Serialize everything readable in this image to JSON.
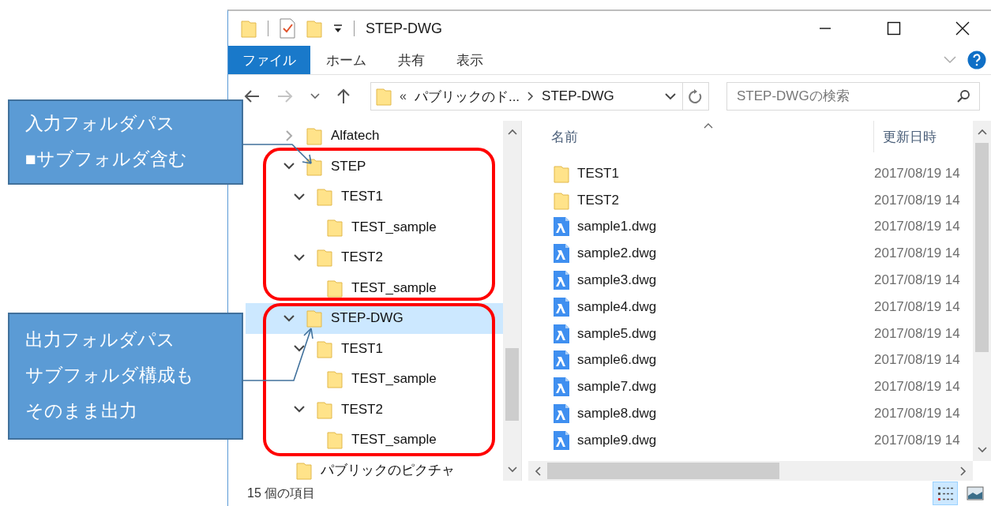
{
  "window": {
    "title": "STEP-DWG"
  },
  "ribbon": {
    "tabs": [
      {
        "label": "ファイル",
        "selected": true
      },
      {
        "label": "ホーム",
        "selected": false
      },
      {
        "label": "共有",
        "selected": false
      },
      {
        "label": "表示",
        "selected": false
      }
    ]
  },
  "address_bar": {
    "overflow": "«",
    "path": [
      "パブリックのド...",
      "STEP-DWG"
    ]
  },
  "search": {
    "placeholder": "STEP-DWGの検索"
  },
  "nav_pane": {
    "items": [
      {
        "name": "Alfatech",
        "expanded": false,
        "selected": false
      },
      {
        "name": "STEP",
        "expanded": true,
        "selected": false,
        "children": [
          {
            "name": "TEST1",
            "expanded": true,
            "selected": false,
            "children": [
              {
                "name": "TEST_sample",
                "selected": false
              }
            ]
          },
          {
            "name": "TEST2",
            "expanded": true,
            "selected": false,
            "children": [
              {
                "name": "TEST_sample",
                "selected": false
              }
            ]
          }
        ]
      },
      {
        "name": "STEP-DWG",
        "expanded": true,
        "selected": true,
        "children": [
          {
            "name": "TEST1",
            "expanded": true,
            "selected": false,
            "children": [
              {
                "name": "TEST_sample",
                "selected": false
              }
            ]
          },
          {
            "name": "TEST2",
            "expanded": true,
            "selected": false,
            "children": [
              {
                "name": "TEST_sample",
                "selected": false
              }
            ]
          }
        ]
      }
    ],
    "parent_level_items": [
      {
        "name": "パブリックのピクチャ",
        "selected": false
      }
    ]
  },
  "file_list": {
    "columns": [
      "名前",
      "更新日時"
    ],
    "rows": [
      {
        "kind": "folder",
        "name": "TEST1",
        "modified": "2017/08/19 14"
      },
      {
        "kind": "folder",
        "name": "TEST2",
        "modified": "2017/08/19 14"
      },
      {
        "kind": "dwg",
        "name": "sample1.dwg",
        "modified": "2017/08/19 14"
      },
      {
        "kind": "dwg",
        "name": "sample2.dwg",
        "modified": "2017/08/19 14"
      },
      {
        "kind": "dwg",
        "name": "sample3.dwg",
        "modified": "2017/08/19 14"
      },
      {
        "kind": "dwg",
        "name": "sample4.dwg",
        "modified": "2017/08/19 14"
      },
      {
        "kind": "dwg",
        "name": "sample5.dwg",
        "modified": "2017/08/19 14"
      },
      {
        "kind": "dwg",
        "name": "sample6.dwg",
        "modified": "2017/08/19 14"
      },
      {
        "kind": "dwg",
        "name": "sample7.dwg",
        "modified": "2017/08/19 14"
      },
      {
        "kind": "dwg",
        "name": "sample8.dwg",
        "modified": "2017/08/19 14"
      },
      {
        "kind": "dwg",
        "name": "sample9.dwg",
        "modified": "2017/08/19 14"
      }
    ]
  },
  "status_bar": {
    "item_count": "15 個の項目",
    "views": [
      {
        "kind": "details",
        "selected": true
      },
      {
        "kind": "thumbnails",
        "selected": false
      }
    ]
  },
  "callouts": [
    {
      "lines": [
        "入力フォルダパス",
        "■サブフォルダ含む"
      ]
    },
    {
      "lines": [
        "出力フォルダパス",
        "サブフォルダ構成も",
        "そのまま出力"
      ]
    }
  ]
}
